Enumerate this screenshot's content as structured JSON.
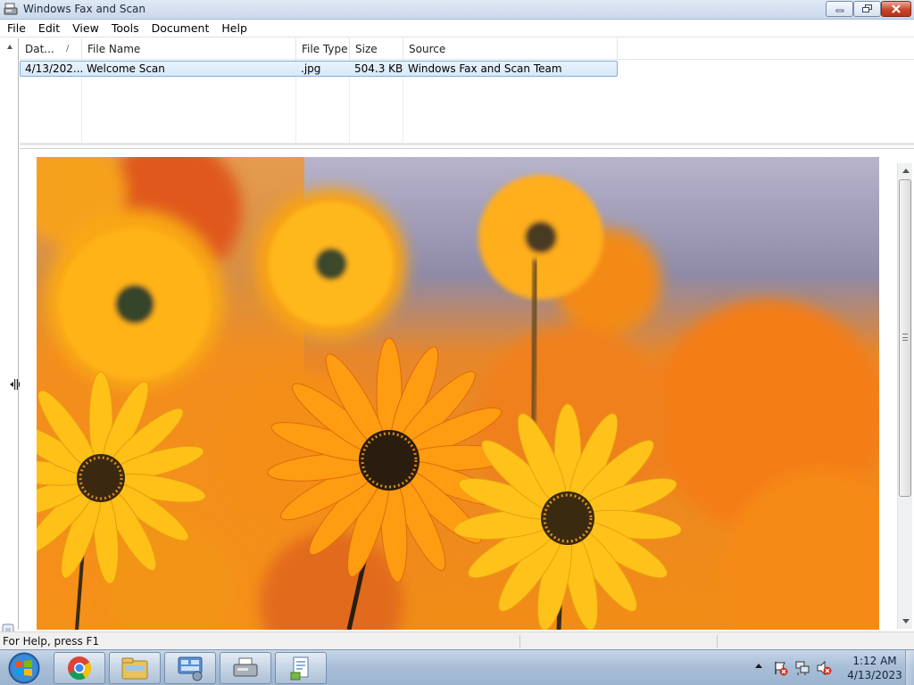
{
  "window": {
    "title": "Windows Fax and Scan",
    "controls": {
      "minimize": "minimize-icon",
      "maximize": "restore-icon",
      "close": "close-icon"
    }
  },
  "menu": {
    "items": [
      {
        "label": "File"
      },
      {
        "label": "Edit"
      },
      {
        "label": "View"
      },
      {
        "label": "Tools"
      },
      {
        "label": "Document"
      },
      {
        "label": "Help"
      }
    ]
  },
  "list": {
    "columns": [
      {
        "label": "Dat..."
      },
      {
        "label": "File Name"
      },
      {
        "label": "File Type"
      },
      {
        "label": "Size"
      },
      {
        "label": "Source"
      }
    ],
    "sort_indicator": "/",
    "rows": [
      {
        "date": "4/13/202...",
        "name": "Welcome Scan",
        "type": ".jpg",
        "size": "504.3 KB",
        "source": "Windows Fax and Scan Team",
        "selected": true
      }
    ]
  },
  "preview": {
    "content": "orange gerbera daisies photo"
  },
  "status": {
    "text": "For Help, press F1"
  },
  "taskbar": {
    "start": "windows-start-orb",
    "apps": [
      "chrome-icon",
      "file-explorer-icon",
      "control-panel-icon",
      "fax-scanner-icon",
      "document-viewer-icon"
    ],
    "clock_time": "1:12 AM",
    "clock_date": "4/13/2023"
  },
  "colors": {
    "selection": "#d7e8fb",
    "selection_border": "#84acdd",
    "taskbar": "#a9bfd8",
    "close_button": "#c9452c"
  }
}
